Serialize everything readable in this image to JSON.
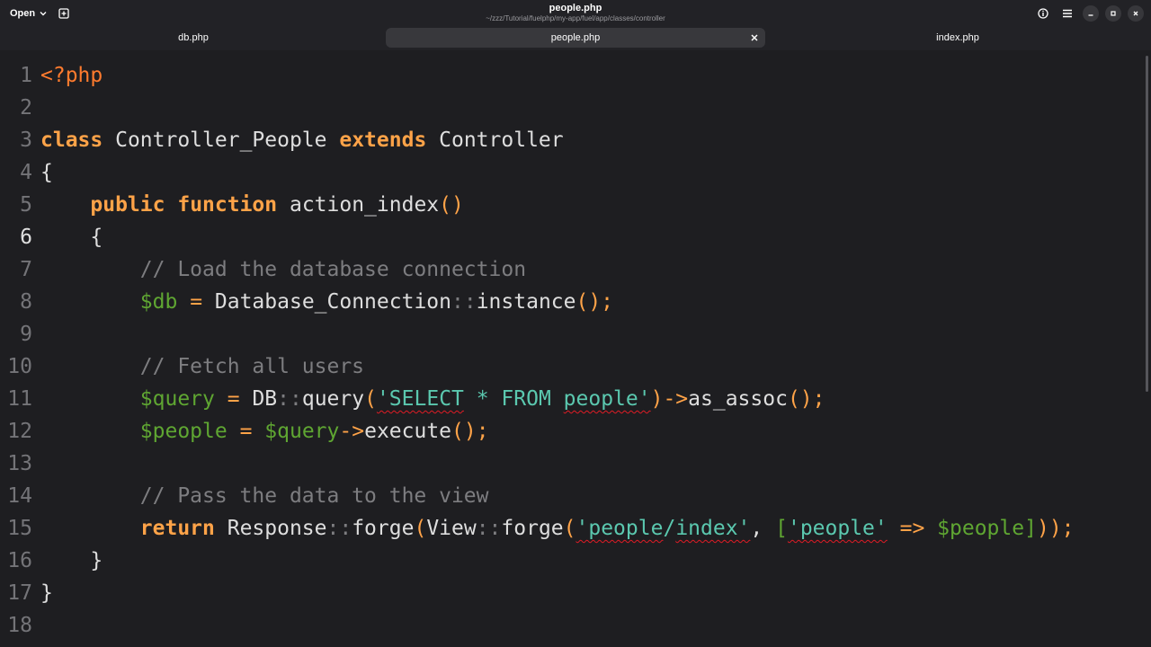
{
  "header": {
    "open_label": "Open",
    "title": "people.php",
    "subtitle": "~/zzz/Tutorial/fuelphp/my-app/fuel/app/classes/controller"
  },
  "tabs": [
    {
      "label": "db.php",
      "active": false
    },
    {
      "label": "people.php",
      "active": true
    },
    {
      "label": "index.php",
      "active": false
    }
  ],
  "icons": {
    "open_menu": "chevron-down-icon",
    "new_tab": "new-tab-icon",
    "info": "info-icon",
    "menu": "hamburger-menu-icon",
    "minimize": "minimize-icon",
    "maximize": "maximize-icon",
    "close": "close-icon",
    "tab_close": "close-icon"
  },
  "colors": {
    "keyword": "#ffa348",
    "php_tag": "#ff7b2e",
    "string": "#5bc8af",
    "variable": "#5fa632",
    "comment": "#7d7d80",
    "text": "#dedede",
    "background": "#1e1e21"
  },
  "editor": {
    "current_line": 6,
    "lines": [
      {
        "n": "1",
        "segments": [
          {
            "t": "<?php",
            "c": "php"
          }
        ]
      },
      {
        "n": "2",
        "segments": []
      },
      {
        "n": "3",
        "segments": [
          {
            "t": "class",
            "c": "kw"
          },
          {
            "t": " Controller_People ",
            "c": ""
          },
          {
            "t": "extends",
            "c": "kw"
          },
          {
            "t": " Controller",
            "c": ""
          }
        ]
      },
      {
        "n": "4",
        "segments": [
          {
            "t": "{",
            "c": ""
          }
        ]
      },
      {
        "n": "5",
        "segments": [
          {
            "t": "    ",
            "c": ""
          },
          {
            "t": "public",
            "c": "kw"
          },
          {
            "t": " ",
            "c": ""
          },
          {
            "t": "function",
            "c": "kw"
          },
          {
            "t": " action_index",
            "c": ""
          },
          {
            "t": "()",
            "c": "op"
          }
        ]
      },
      {
        "n": "6",
        "segments": [
          {
            "t": "    {",
            "c": ""
          }
        ]
      },
      {
        "n": "7",
        "segments": [
          {
            "t": "        ",
            "c": ""
          },
          {
            "t": "// Load the database connection",
            "c": "cm"
          }
        ]
      },
      {
        "n": "8",
        "segments": [
          {
            "t": "        ",
            "c": ""
          },
          {
            "t": "$db",
            "c": "var"
          },
          {
            "t": " ",
            "c": ""
          },
          {
            "t": "=",
            "c": "op"
          },
          {
            "t": " Database_Connection",
            "c": ""
          },
          {
            "t": "::",
            "c": "cm"
          },
          {
            "t": "instance",
            "c": ""
          },
          {
            "t": "();",
            "c": "op"
          }
        ]
      },
      {
        "n": "9",
        "segments": []
      },
      {
        "n": "10",
        "segments": [
          {
            "t": "        ",
            "c": ""
          },
          {
            "t": "// Fetch all users",
            "c": "cm"
          }
        ]
      },
      {
        "n": "11",
        "segments": [
          {
            "t": "        ",
            "c": ""
          },
          {
            "t": "$query",
            "c": "var"
          },
          {
            "t": " ",
            "c": ""
          },
          {
            "t": "=",
            "c": "op"
          },
          {
            "t": " DB",
            "c": ""
          },
          {
            "t": "::",
            "c": "cm"
          },
          {
            "t": "query",
            "c": ""
          },
          {
            "t": "(",
            "c": "op"
          },
          {
            "t": "'SELECT",
            "c": "str sp"
          },
          {
            "t": " * FROM ",
            "c": "str"
          },
          {
            "t": "people'",
            "c": "str sp"
          },
          {
            "t": ")->",
            "c": "op"
          },
          {
            "t": "as_assoc",
            "c": ""
          },
          {
            "t": "();",
            "c": "op"
          }
        ]
      },
      {
        "n": "12",
        "segments": [
          {
            "t": "        ",
            "c": ""
          },
          {
            "t": "$people",
            "c": "var"
          },
          {
            "t": " ",
            "c": ""
          },
          {
            "t": "=",
            "c": "op"
          },
          {
            "t": " ",
            "c": ""
          },
          {
            "t": "$query",
            "c": "var"
          },
          {
            "t": "->",
            "c": "op"
          },
          {
            "t": "execute",
            "c": ""
          },
          {
            "t": "();",
            "c": "op"
          }
        ]
      },
      {
        "n": "13",
        "segments": []
      },
      {
        "n": "14",
        "segments": [
          {
            "t": "        ",
            "c": ""
          },
          {
            "t": "// Pass the data to the view",
            "c": "cm"
          }
        ]
      },
      {
        "n": "15",
        "segments": [
          {
            "t": "        ",
            "c": ""
          },
          {
            "t": "return",
            "c": "kw"
          },
          {
            "t": " Response",
            "c": ""
          },
          {
            "t": "::",
            "c": "cm"
          },
          {
            "t": "forge",
            "c": ""
          },
          {
            "t": "(",
            "c": "op"
          },
          {
            "t": "View",
            "c": ""
          },
          {
            "t": "::",
            "c": "cm"
          },
          {
            "t": "forge",
            "c": ""
          },
          {
            "t": "(",
            "c": "op"
          },
          {
            "t": "'people",
            "c": "str sp"
          },
          {
            "t": "/",
            "c": "str"
          },
          {
            "t": "index'",
            "c": "str sp"
          },
          {
            "t": ", ",
            "c": ""
          },
          {
            "t": "[",
            "c": "var"
          },
          {
            "t": "'people'",
            "c": "str sp"
          },
          {
            "t": " ",
            "c": ""
          },
          {
            "t": "=>",
            "c": "op"
          },
          {
            "t": " ",
            "c": ""
          },
          {
            "t": "$people",
            "c": "var"
          },
          {
            "t": "]",
            "c": "var"
          },
          {
            "t": "));",
            "c": "op"
          }
        ]
      },
      {
        "n": "16",
        "segments": [
          {
            "t": "    }",
            "c": ""
          }
        ]
      },
      {
        "n": "17",
        "segments": [
          {
            "t": "}",
            "c": ""
          }
        ]
      },
      {
        "n": "18",
        "segments": []
      }
    ]
  }
}
